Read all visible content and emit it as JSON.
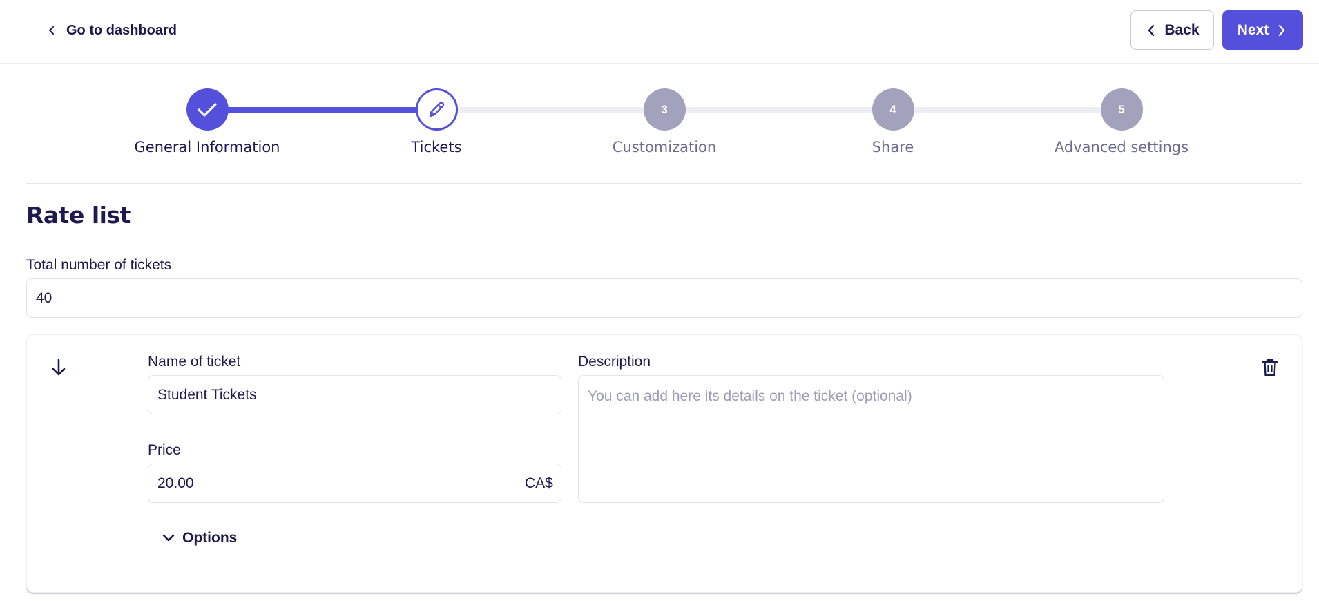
{
  "header": {
    "dashboard_link": "Go to dashboard",
    "back_label": "Back",
    "next_label": "Next"
  },
  "stepper": {
    "steps": [
      {
        "number": "1",
        "label": "General Information",
        "state": "completed"
      },
      {
        "number": "2",
        "label": "Tickets",
        "state": "current"
      },
      {
        "number": "3",
        "label": "Customization",
        "state": "pending"
      },
      {
        "number": "4",
        "label": "Share",
        "state": "pending"
      },
      {
        "number": "5",
        "label": "Advanced settings",
        "state": "pending"
      }
    ]
  },
  "rate_list": {
    "title": "Rate list",
    "total_tickets_label": "Total number of tickets",
    "total_tickets_value": "40"
  },
  "ticket": {
    "name_label": "Name of ticket",
    "name_value": "Student Tickets",
    "description_label": "Description",
    "description_placeholder": "You can add here its details on the ticket (optional)",
    "price_label": "Price",
    "price_value": "20.00",
    "currency": "CA$",
    "options_label": "Options"
  },
  "icons": {
    "back_link": "chevron-left-icon",
    "completed_step": "check-icon",
    "current_step": "pencil-icon",
    "reorder": "arrow-down-icon",
    "delete": "trash-icon",
    "options": "chevron-down-icon"
  },
  "colors": {
    "primary": "#5450dc",
    "text": "#1c1a4e",
    "pending_step": "#a3a2bd",
    "muted_text": "#6d6c8f",
    "placeholder": "#9e9cb6",
    "border": "#e2e2e9"
  }
}
